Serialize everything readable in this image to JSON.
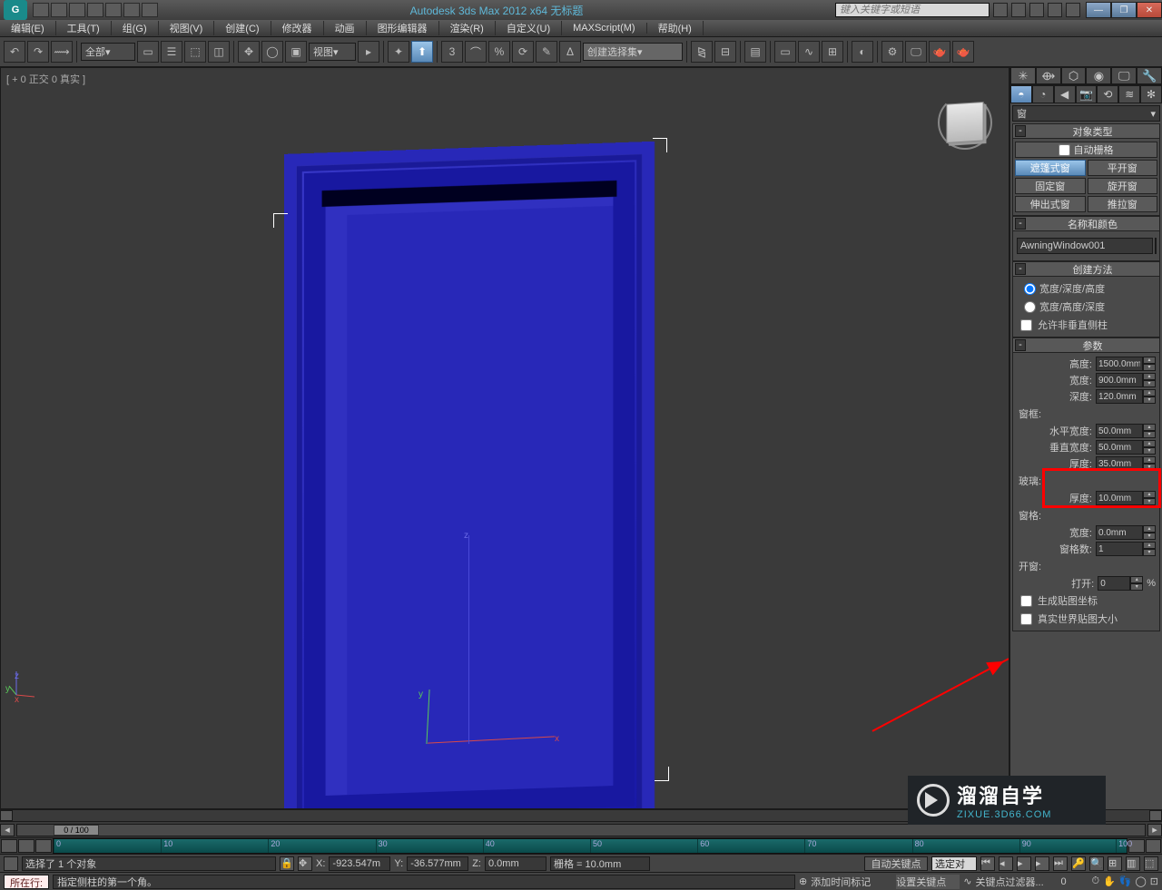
{
  "title": "Autodesk 3ds Max  2012  x64     无标题",
  "search_placeholder": "键入关键字或短语",
  "menu": [
    "编辑(E)",
    "工具(T)",
    "组(G)",
    "视图(V)",
    "创建(C)",
    "修改器",
    "动画",
    "图形编辑器",
    "渲染(R)",
    "自定义(U)",
    "MAXScript(M)",
    "帮助(H)"
  ],
  "toolbar": {
    "filter_all": "全部",
    "view_mode": "视图",
    "create_set": "创建选择集"
  },
  "viewport": {
    "label": "[ + 0 正交 0 真实 ]",
    "axis": {
      "x": "x",
      "y": "y",
      "z": "z"
    }
  },
  "cmdpanel": {
    "category": "窗",
    "rollouts": {
      "object_type": "对象类型",
      "auto_grid": "自动栅格",
      "types": [
        "遮篷式窗",
        "平开窗",
        "固定窗",
        "旋开窗",
        "伸出式窗",
        "推拉窗"
      ],
      "name_color": "名称和颜色",
      "object_name": "AwningWindow001",
      "creation_method": "创建方法",
      "method1": "宽度/深度/高度",
      "method2": "宽度/高度/深度",
      "allow_non_vert": "允许非垂直侧柱",
      "params_hdr": "参数",
      "height_lbl": "高度:",
      "height": "1500.0mm",
      "width_lbl": "宽度:",
      "width": "900.0mm",
      "depth_lbl": "深度:",
      "depth": "120.0mm",
      "frame_grp": "窗框:",
      "hframe_lbl": "水平宽度:",
      "hframe": "50.0mm",
      "vframe_lbl": "垂直宽度:",
      "vframe": "50.0mm",
      "fthick_lbl": "厚度:",
      "fthick": "35.0mm",
      "glass_grp": "玻璃:",
      "gthick_lbl": "厚度:",
      "gthick": "10.0mm",
      "rail_grp": "窗格:",
      "rwidth_lbl": "宽度:",
      "rwidth": "0.0mm",
      "rcount_lbl": "窗格数:",
      "rcount": "1",
      "open_grp": "开窗:",
      "open_lbl": "打开:",
      "open_val": "0",
      "open_pct": "%",
      "gen_map": "生成贴图坐标",
      "real_world": "真实世界贴图大小"
    }
  },
  "trackbar": {
    "frame": "0 / 100"
  },
  "timeline": {
    "ticks": [
      "0",
      "10",
      "20",
      "30",
      "40",
      "50",
      "60",
      "70",
      "80",
      "90",
      "100"
    ]
  },
  "status": {
    "sel_msg": "选择了 1 个对象",
    "x_lbl": "X:",
    "x": "-923.547m",
    "y_lbl": "Y:",
    "y": "-36.577mm",
    "z_lbl": "Z:",
    "z": "0.0mm",
    "grid": "栅格 = 10.0mm",
    "autokey": "自动关键点",
    "selset": "选定对",
    "prompt_label": "所在行:",
    "prompt_msg": "指定侧柱的第一个角。",
    "add_time": "添加时间标记",
    "setkey": "设置关键点",
    "keyfilter": "关键点过滤器..."
  },
  "watermark": {
    "brand": "溜溜自学",
    "url": "ZIXUE.3D66.COM"
  }
}
